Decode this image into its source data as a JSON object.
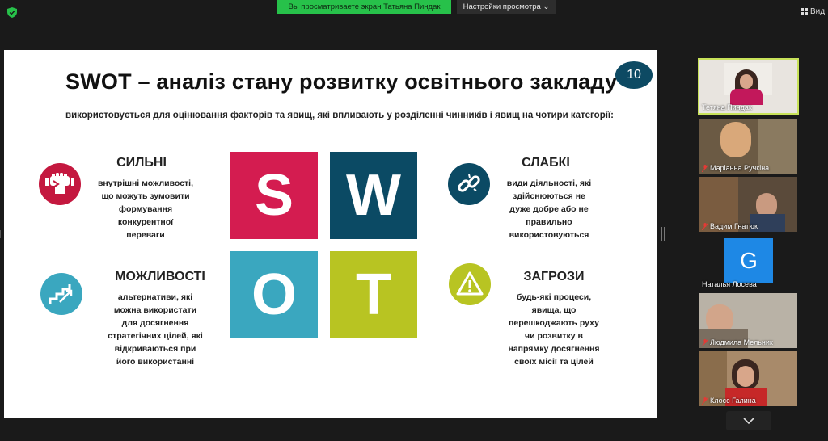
{
  "topbar": {
    "share_banner": "Вы просматриваете экран Татьяна Пиндак",
    "viewer_settings": "Настройки просмотра",
    "view_label": "Вид"
  },
  "slide": {
    "title": "SWOT – аналіз стану розвитку освітнього закладу",
    "number": "10",
    "subtitle": "використовується для оцінювання факторів та явищ, які впливають у розділенні чинників і явищ на чотири категорії:",
    "tiles": [
      "S",
      "W",
      "O",
      "T"
    ],
    "categories": {
      "strengths": {
        "title": "СИЛЬНІ",
        "desc_lines": [
          "внутрішні можливості,",
          "що можуть зумовити",
          "формування",
          "конкурентної",
          "переваги"
        ]
      },
      "weaknesses": {
        "title": "СЛАБКІ",
        "desc_lines": [
          "види діяльності, які",
          "здійснюються не",
          "дуже добре або не",
          "правильно",
          "використовуються"
        ]
      },
      "opportunities": {
        "title": "МОЖЛИВОСТІ",
        "desc_lines": [
          "альтернативи, які",
          "можна використати",
          "для досягнення",
          "стратегічних цілей, які",
          "відкриваються при",
          "його використанні"
        ]
      },
      "threats": {
        "title": "ЗАГРОЗИ",
        "desc_lines": [
          "будь-які процеси,",
          "явища, що",
          "перешкоджають руху",
          "чи розвитку в",
          "напрямку досягнення",
          "своїх  місії та цілей"
        ]
      }
    },
    "colors": {
      "s": "#d41c50",
      "w": "#0b4a64",
      "o": "#3aa7bf",
      "t": "#b8c422"
    }
  },
  "participants": [
    {
      "name": "Тетяна Пиндак",
      "muted": false
    },
    {
      "name": "Маріанна Ручкіна",
      "muted": true
    },
    {
      "name": "Вадим Гнатюк",
      "muted": true
    },
    {
      "name": "Наталья Лосева",
      "muted": false,
      "avatar_letter": "G"
    },
    {
      "name": "Людмила Мельник",
      "muted": true
    },
    {
      "name": "Клосс Галина",
      "muted": true
    }
  ]
}
